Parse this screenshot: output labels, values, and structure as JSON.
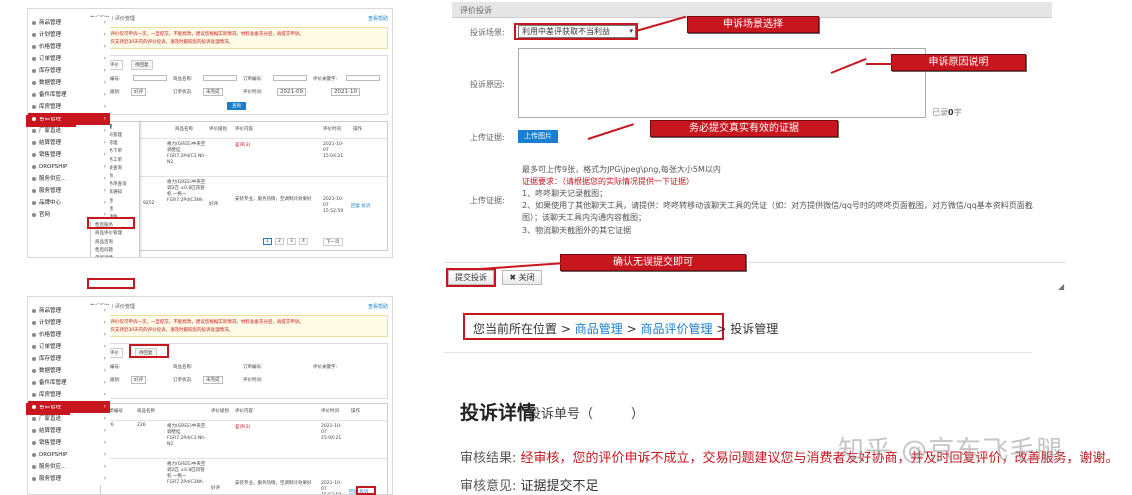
{
  "top_left": {
    "breadcrumb": "售后服务 / 评价管理",
    "help_link": "查看帮助",
    "notice": [
      "1、每条评价仅可申诉一次，一旦提交，不能修改，建议您根据实际情况，材料准备充分后，再提交申诉。",
      "2、目前仅支持近30天内的评价投诉，请及时跟踪您的投诉处理情况。"
    ],
    "tabs": [
      "全部评价",
      "待回复"
    ],
    "filters": {
      "product_id": "商品编号:",
      "product_name": "商品名称:",
      "order_id": "订单编号:",
      "keyword": "评价关键字:",
      "rating": "评价级别:",
      "rating_value": "好评",
      "status": "订单状态:",
      "status_value": "未完成",
      "time": "评价时间:",
      "date_from": "2021-09",
      "date_to": "2021-10",
      "query_button": "查询"
    },
    "table_headers": [
      "订单编号",
      "商品名称",
      "评价级别",
      "评价内容",
      "评价时间",
      "操作"
    ],
    "rows": [
      {
        "id": "276",
        "sub": "226",
        "name": "格力(GREE)中央空调壁挂 FGR7.2Pd/C3 Nh-N2",
        "level": "",
        "content": "差评(3)",
        "time": "2021-10-07 15:04:21",
        "op": ""
      },
      {
        "id": "9252",
        "sub": "",
        "name": "格力(GREE)中央空调2匹 ±0.8匹风管机 一拖一 FGR7.2Pd/C3Nh",
        "level": "好评",
        "content": "安装专业，服务热情，空调制冷效果好",
        "time": "2021-10-07 15:52:59",
        "op": "回复 投诉"
      }
    ],
    "pager": [
      "1",
      "2",
      "3",
      "4"
    ],
    "pager_next": "下一页",
    "flyout_header": "售后管理",
    "flyout_items": [
      "售后人员管理",
      "服务单管理",
      "代理服务下单",
      "维权服务工单",
      "发票记录查询",
      "发票查询",
      "售后服务单查询",
      "售后商家通知",
      "售后问题",
      "订单问题",
      "售后问题件"
    ],
    "flyout2_items": [
      "售后服务",
      "商品评价管理",
      "商品咨询",
      "售后问题",
      "单据详情",
      "工单管理",
      "用户取消订单",
      "售后管理",
      "评价管理"
    ]
  },
  "sidebar": [
    {
      "label": "商品管理"
    },
    {
      "label": "计划管理"
    },
    {
      "label": "价格管理"
    },
    {
      "label": "订单管理"
    },
    {
      "label": "库存管理"
    },
    {
      "label": "数据管理"
    },
    {
      "label": "备件库管理"
    },
    {
      "label": "库房管理"
    },
    {
      "label": "售后管理"
    },
    {
      "label": "厂家直送"
    },
    {
      "label": "结算管理"
    },
    {
      "label": "销售管理"
    },
    {
      "label": "DROPSHIP"
    },
    {
      "label": "服务供应..."
    },
    {
      "label": "服务管理"
    },
    {
      "label": "品牌中心"
    },
    {
      "label": "官网"
    }
  ],
  "sidebar2": [
    {
      "label": "商品管理"
    },
    {
      "label": "计划管理"
    },
    {
      "label": "价格管理"
    },
    {
      "label": "订单管理"
    },
    {
      "label": "库存管理"
    },
    {
      "label": "数据管理"
    },
    {
      "label": "备件库管理"
    },
    {
      "label": "库房管理"
    },
    {
      "label": "售后管理"
    },
    {
      "label": "厂家直送"
    },
    {
      "label": "结算管理"
    },
    {
      "label": "销售管理"
    },
    {
      "label": "DROPSHIP"
    },
    {
      "label": "服务供应..."
    },
    {
      "label": "服务管理"
    }
  ],
  "form": {
    "section_title": "评价投诉",
    "scene_label": "投诉场景:",
    "scene_value": "利用中差评获取不当利益",
    "reason_label": "投诉原因:",
    "char_count_prefix": "已录",
    "char_count_value": "0",
    "char_count_suffix": "字",
    "upload_label": "上传证据:",
    "upload_button": "上传图片",
    "upload_label2": "上传证据:",
    "upload_hint1": "最多可上传9张，格式为JPG\\jpeg\\png,每张大小5M以内",
    "evidence_title": "证据要求：（请根据您的实际情况提供一下证据）",
    "evidence_1": "1、咚咚聊天记录截图；",
    "evidence_2": "2、如果使用了其他聊天工具，请提供：咚咚转移动该聊天工具的凭证（如：对方提供微信/qq号时的咚咚页面截图，对方微信/qq基本资料页面截图）；该聊天工具内沟通内容截图；",
    "evidence_3": "3、物流聊天截图外的其它证据",
    "submit_button": "提交投诉",
    "close_button": "关闭"
  },
  "callouts": {
    "scene": "申诉场景选择",
    "reason": "申诉原因说明",
    "evidence": "务必提交真实有效的证据",
    "confirm": "确认无误提交即可"
  },
  "location": {
    "prefix": "您当前所在位置",
    "sep1": ">",
    "link1": "商品管理",
    "sep2": ">",
    "link2": "商品评价管理",
    "sep3": ">",
    "current": "投诉管理"
  },
  "detail": {
    "title": "投诉详情",
    "id_label": "投诉单号（",
    "id_close": "）",
    "result_label": "审核结果:",
    "result_value": "经审核，您的评价申诉不成立，交易问题建议您与消费者友好协商，并及时回复评价，改善服务，谢谢。",
    "opinion_label": "审核意见:",
    "opinion_value": "证据提交不足"
  },
  "watermark": "知乎 @京东飞毛腿"
}
